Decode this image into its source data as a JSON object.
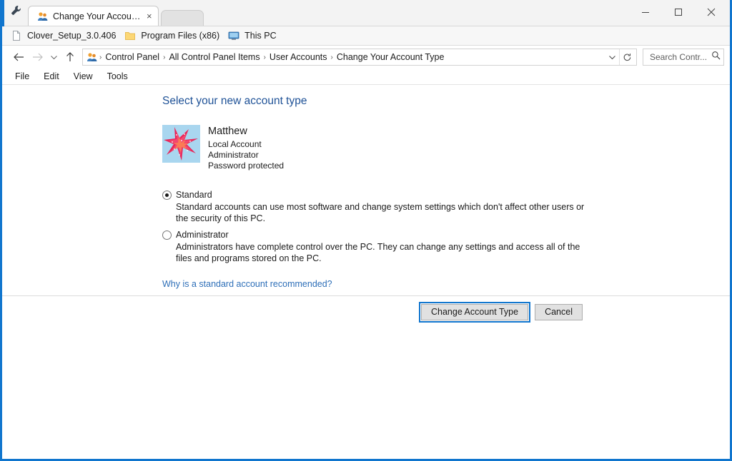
{
  "window": {
    "app_icon": "wrench-icon",
    "controls": {
      "minimize": "minimize-icon",
      "maximize": "maximize-icon",
      "close": "close-icon"
    }
  },
  "tabs": [
    {
      "label": "Change Your Account Typ",
      "icon": "user-accounts-icon",
      "close": "×",
      "active": true
    }
  ],
  "bookmarks": [
    {
      "label": "Clover_Setup_3.0.406",
      "icon": "file-icon"
    },
    {
      "label": "Program Files (x86)",
      "icon": "folder-icon"
    },
    {
      "label": "This PC",
      "icon": "computer-icon"
    }
  ],
  "address": {
    "back_icon": "back-arrow-icon",
    "forward_icon": "forward-arrow-icon",
    "history_icon": "chevron-down-icon",
    "up_icon": "up-arrow-icon",
    "crumb_icon": "user-accounts-icon",
    "breadcrumbs": [
      "Control Panel",
      "All Control Panel Items",
      "User Accounts",
      "Change Your Account Type"
    ],
    "separator": "›",
    "dropdown_icon": "chevron-down-icon",
    "refresh_icon": "refresh-icon"
  },
  "search": {
    "placeholder": "Search Contr...",
    "value": "",
    "icon": "search-icon"
  },
  "menu": {
    "items": [
      "File",
      "Edit",
      "View",
      "Tools"
    ]
  },
  "main": {
    "heading": "Select your new account type",
    "account": {
      "name": "Matthew",
      "meta": [
        "Local Account",
        "Administrator",
        "Password protected"
      ],
      "avatar_icon": "starfish-avatar"
    },
    "options": [
      {
        "label": "Standard",
        "selected": true,
        "description": "Standard accounts can use most software and change system settings which don't affect other users or the security of this PC."
      },
      {
        "label": "Administrator",
        "selected": false,
        "description": "Administrators have complete control over the PC. They can change any settings and access all of the files and programs stored on the PC."
      }
    ],
    "help_link": "Why is a standard account recommended?"
  },
  "actions": {
    "primary": "Change Account Type",
    "secondary": "Cancel"
  },
  "colors": {
    "window_border": "#1176ce",
    "heading": "#1f5297",
    "link": "#2e6fb8",
    "focus": "#1176ce",
    "button_face": "#e1e1e1"
  }
}
